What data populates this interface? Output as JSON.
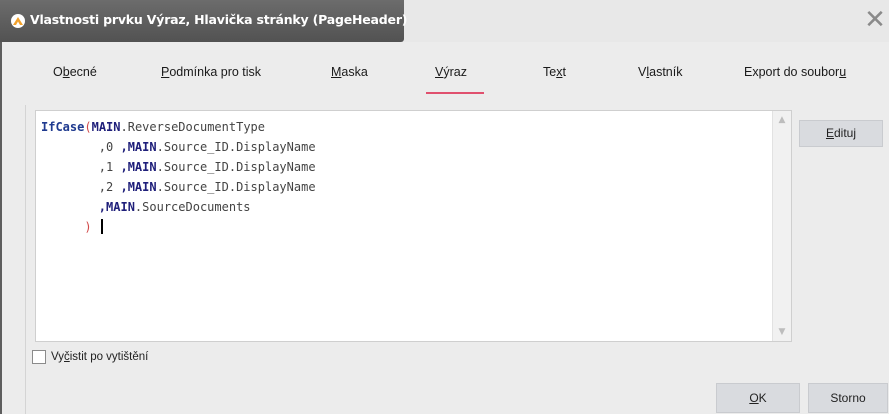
{
  "window": {
    "title": "Vlastnosti prvku Výraz, Hlavička stránky (PageHeader)",
    "close_glyph": "✕"
  },
  "tabs": [
    {
      "pre": "O",
      "acc": "b",
      "post": "ecné"
    },
    {
      "pre": "",
      "acc": "P",
      "post": "odmínka pro tisk"
    },
    {
      "pre": "",
      "acc": "M",
      "post": "aska"
    },
    {
      "pre": "",
      "acc": "V",
      "post": "ýraz"
    },
    {
      "pre": "Te",
      "acc": "x",
      "post": "t"
    },
    {
      "pre": "V",
      "acc": "l",
      "post": "astník"
    },
    {
      "pre": "Export do soubor",
      "acc": "u",
      "post": ""
    }
  ],
  "active_tab": "Výraz",
  "editor": {
    "lines": [
      [
        [
          "fn",
          "IfCase"
        ],
        [
          "pa",
          "("
        ],
        [
          "kw",
          "MAIN"
        ],
        [
          "pl",
          ".ReverseDocumentType"
        ]
      ],
      [
        [
          "pl",
          "        ,0 "
        ],
        [
          "kw",
          ",MAIN"
        ],
        [
          "pl",
          ".Source_ID.DisplayName"
        ]
      ],
      [
        [
          "pl",
          "        ,1 "
        ],
        [
          "kw",
          ",MAIN"
        ],
        [
          "pl",
          ".Source_ID.DisplayName"
        ]
      ],
      [
        [
          "pl",
          "        ,2 "
        ],
        [
          "kw",
          ",MAIN"
        ],
        [
          "pl",
          ".Source_ID.DisplayName"
        ]
      ],
      [
        [
          "pl",
          "        "
        ],
        [
          "kw",
          ",MAIN"
        ],
        [
          "pl",
          ".SourceDocuments"
        ]
      ],
      [
        [
          "pl",
          "      "
        ],
        [
          "pa",
          ")"
        ],
        [
          "pl",
          " "
        ]
      ]
    ]
  },
  "buttons": {
    "edit": {
      "pre": "",
      "acc": "E",
      "post": "dituj"
    },
    "ok": {
      "pre": "",
      "acc": "O",
      "post": "K"
    },
    "cancel": "Storno"
  },
  "checkbox": {
    "pre": "Vy",
    "acc": "č",
    "post": "istit po vytištění",
    "checked": false
  },
  "colors": {
    "accent": "#e0506e",
    "title_bar": "#5e5e5e",
    "keyword": "#1f3a8f",
    "paren": "#d14a4a"
  },
  "icons": {
    "app": "app-logo-icon",
    "close": "close-icon",
    "scroll_up": "scroll-up-icon",
    "scroll_down": "scroll-down-icon"
  }
}
